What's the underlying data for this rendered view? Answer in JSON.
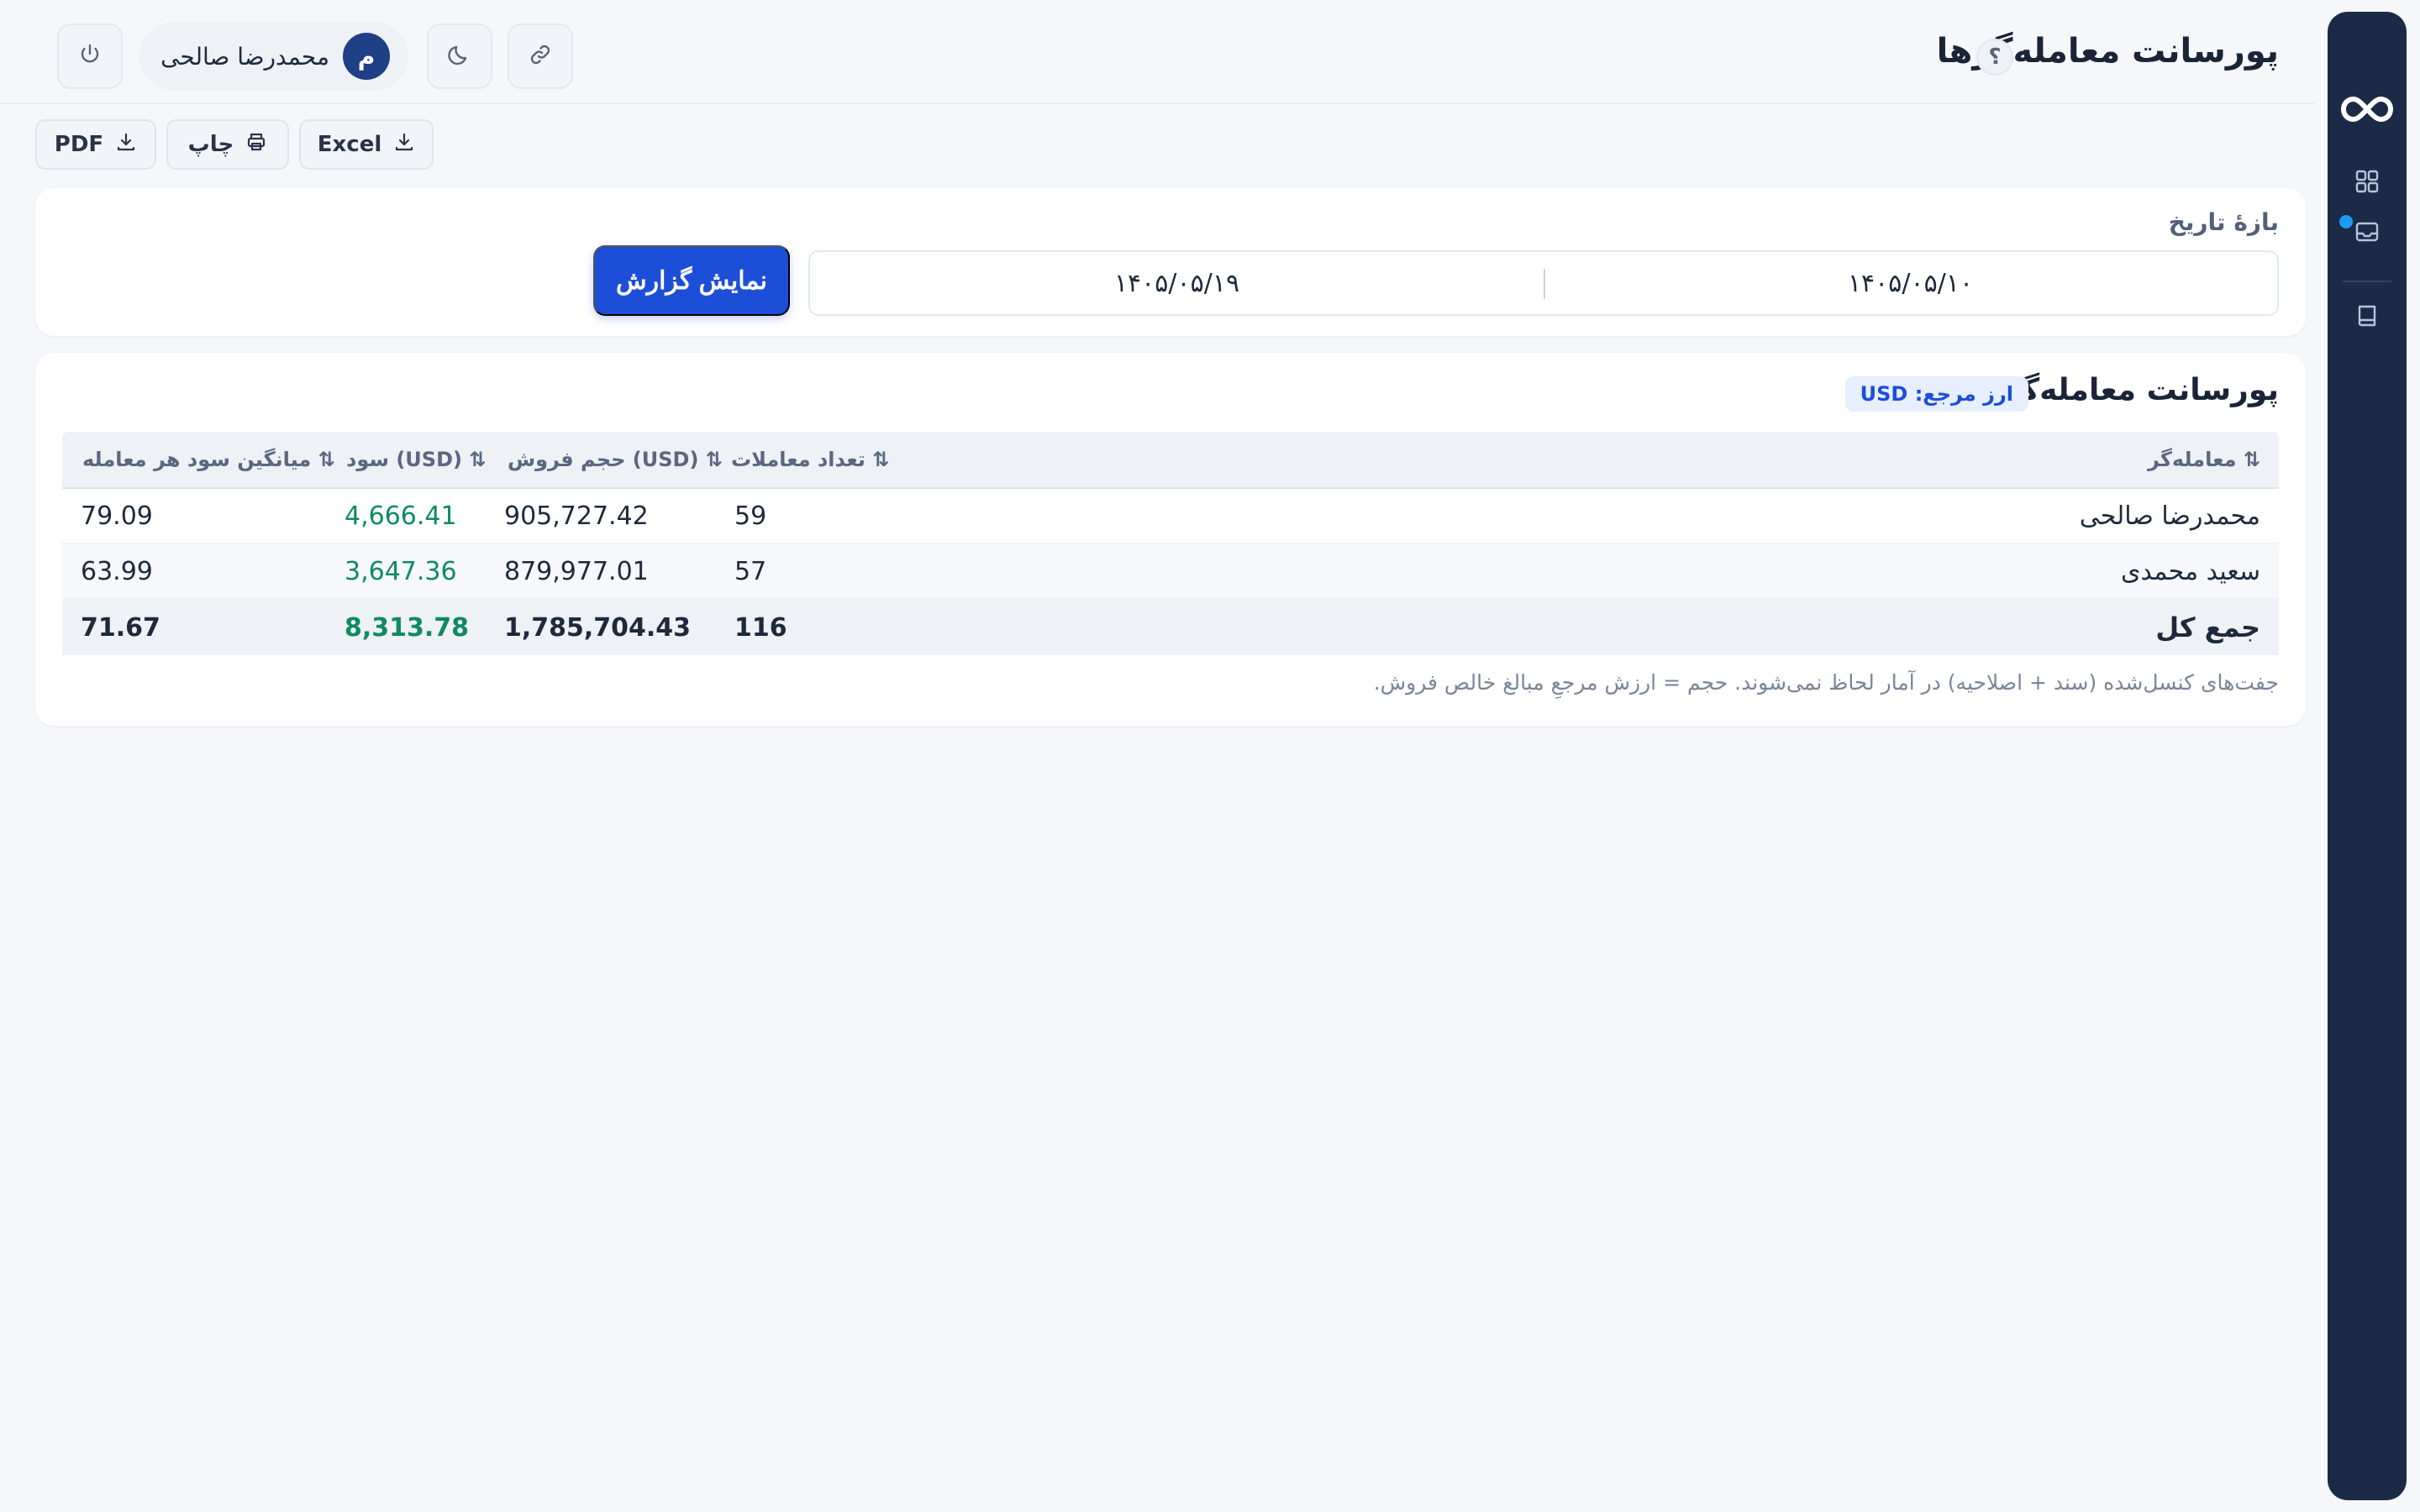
{
  "header": {
    "title": "پورسانت معامله‌گرها",
    "help": "؟",
    "user_name": "محمدرضا صالحی",
    "user_initial": "م"
  },
  "exports": {
    "excel": "Excel",
    "print": "چاپ",
    "pdf": "PDF"
  },
  "filter": {
    "label": "بازهٔ تاریخ",
    "from": "۱۴۰۵/۰۵/۱۰",
    "to": "۱۴۰۵/۰۵/۱۹",
    "submit": "نمایش گزارش"
  },
  "report": {
    "title": "پورسانت معامله‌گرها",
    "currency_badge": "ارز مرجع: USD",
    "columns": {
      "trader": "⇅ معامله‌گر",
      "count": "⇅ تعداد معاملات",
      "volume": "⇅ (USD) حجم فروش",
      "profit": "⇅ (USD) سود",
      "avg": "⇅ میانگین سود هر معامله"
    },
    "rows": [
      {
        "trader": "محمدرضا صالحی",
        "count": "59",
        "volume": "905,727.42",
        "profit": "4,666.41",
        "avg": "79.09"
      },
      {
        "trader": "سعید محمدی",
        "count": "57",
        "volume": "879,977.01",
        "profit": "3,647.36",
        "avg": "63.99"
      }
    ],
    "total": {
      "trader": "جمع کل",
      "count": "116",
      "volume": "1,785,704.43",
      "profit": "8,313.78",
      "avg": "71.67"
    },
    "note": "جفت‌های کنسل‌شده (سند + اصلاحیه) در آمار لحاظ نمی‌شوند. حجم = ارزش مرجعِ مبالغ خالص فروش."
  },
  "icons": {
    "rail": [
      "infinity-logo-icon",
      "dashboard-icon",
      "inbox-icon",
      "book-icon"
    ],
    "header": [
      "power-icon",
      "moon-icon",
      "link-icon"
    ]
  },
  "colors": {
    "primary": "#1d4ed8",
    "rail": "#1b2b47",
    "profit": "#0f8a5f",
    "badge_dot": "#1d9bf0"
  }
}
